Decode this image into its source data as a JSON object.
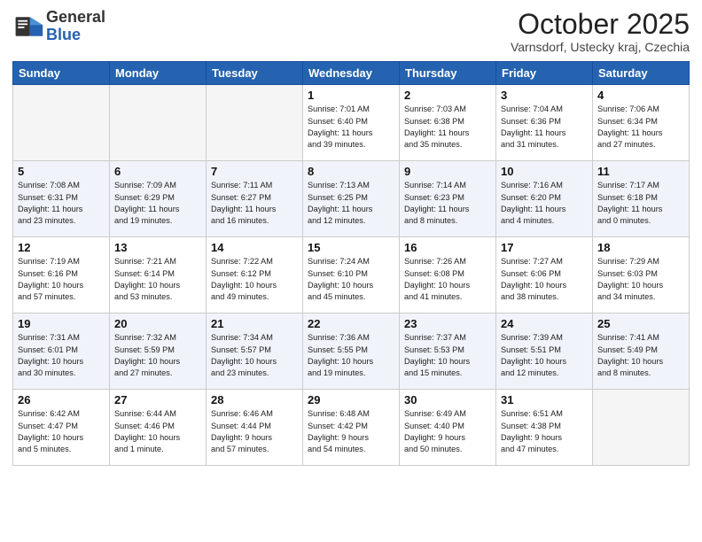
{
  "logo": {
    "general": "General",
    "blue": "Blue"
  },
  "header": {
    "month": "October 2025",
    "location": "Varnsdorf, Ustecky kraj, Czechia"
  },
  "weekdays": [
    "Sunday",
    "Monday",
    "Tuesday",
    "Wednesday",
    "Thursday",
    "Friday",
    "Saturday"
  ],
  "weeks": [
    [
      {
        "day": "",
        "info": ""
      },
      {
        "day": "",
        "info": ""
      },
      {
        "day": "",
        "info": ""
      },
      {
        "day": "1",
        "info": "Sunrise: 7:01 AM\nSunset: 6:40 PM\nDaylight: 11 hours\nand 39 minutes."
      },
      {
        "day": "2",
        "info": "Sunrise: 7:03 AM\nSunset: 6:38 PM\nDaylight: 11 hours\nand 35 minutes."
      },
      {
        "day": "3",
        "info": "Sunrise: 7:04 AM\nSunset: 6:36 PM\nDaylight: 11 hours\nand 31 minutes."
      },
      {
        "day": "4",
        "info": "Sunrise: 7:06 AM\nSunset: 6:34 PM\nDaylight: 11 hours\nand 27 minutes."
      }
    ],
    [
      {
        "day": "5",
        "info": "Sunrise: 7:08 AM\nSunset: 6:31 PM\nDaylight: 11 hours\nand 23 minutes."
      },
      {
        "day": "6",
        "info": "Sunrise: 7:09 AM\nSunset: 6:29 PM\nDaylight: 11 hours\nand 19 minutes."
      },
      {
        "day": "7",
        "info": "Sunrise: 7:11 AM\nSunset: 6:27 PM\nDaylight: 11 hours\nand 16 minutes."
      },
      {
        "day": "8",
        "info": "Sunrise: 7:13 AM\nSunset: 6:25 PM\nDaylight: 11 hours\nand 12 minutes."
      },
      {
        "day": "9",
        "info": "Sunrise: 7:14 AM\nSunset: 6:23 PM\nDaylight: 11 hours\nand 8 minutes."
      },
      {
        "day": "10",
        "info": "Sunrise: 7:16 AM\nSunset: 6:20 PM\nDaylight: 11 hours\nand 4 minutes."
      },
      {
        "day": "11",
        "info": "Sunrise: 7:17 AM\nSunset: 6:18 PM\nDaylight: 11 hours\nand 0 minutes."
      }
    ],
    [
      {
        "day": "12",
        "info": "Sunrise: 7:19 AM\nSunset: 6:16 PM\nDaylight: 10 hours\nand 57 minutes."
      },
      {
        "day": "13",
        "info": "Sunrise: 7:21 AM\nSunset: 6:14 PM\nDaylight: 10 hours\nand 53 minutes."
      },
      {
        "day": "14",
        "info": "Sunrise: 7:22 AM\nSunset: 6:12 PM\nDaylight: 10 hours\nand 49 minutes."
      },
      {
        "day": "15",
        "info": "Sunrise: 7:24 AM\nSunset: 6:10 PM\nDaylight: 10 hours\nand 45 minutes."
      },
      {
        "day": "16",
        "info": "Sunrise: 7:26 AM\nSunset: 6:08 PM\nDaylight: 10 hours\nand 41 minutes."
      },
      {
        "day": "17",
        "info": "Sunrise: 7:27 AM\nSunset: 6:06 PM\nDaylight: 10 hours\nand 38 minutes."
      },
      {
        "day": "18",
        "info": "Sunrise: 7:29 AM\nSunset: 6:03 PM\nDaylight: 10 hours\nand 34 minutes."
      }
    ],
    [
      {
        "day": "19",
        "info": "Sunrise: 7:31 AM\nSunset: 6:01 PM\nDaylight: 10 hours\nand 30 minutes."
      },
      {
        "day": "20",
        "info": "Sunrise: 7:32 AM\nSunset: 5:59 PM\nDaylight: 10 hours\nand 27 minutes."
      },
      {
        "day": "21",
        "info": "Sunrise: 7:34 AM\nSunset: 5:57 PM\nDaylight: 10 hours\nand 23 minutes."
      },
      {
        "day": "22",
        "info": "Sunrise: 7:36 AM\nSunset: 5:55 PM\nDaylight: 10 hours\nand 19 minutes."
      },
      {
        "day": "23",
        "info": "Sunrise: 7:37 AM\nSunset: 5:53 PM\nDaylight: 10 hours\nand 15 minutes."
      },
      {
        "day": "24",
        "info": "Sunrise: 7:39 AM\nSunset: 5:51 PM\nDaylight: 10 hours\nand 12 minutes."
      },
      {
        "day": "25",
        "info": "Sunrise: 7:41 AM\nSunset: 5:49 PM\nDaylight: 10 hours\nand 8 minutes."
      }
    ],
    [
      {
        "day": "26",
        "info": "Sunrise: 6:42 AM\nSunset: 4:47 PM\nDaylight: 10 hours\nand 5 minutes."
      },
      {
        "day": "27",
        "info": "Sunrise: 6:44 AM\nSunset: 4:46 PM\nDaylight: 10 hours\nand 1 minute."
      },
      {
        "day": "28",
        "info": "Sunrise: 6:46 AM\nSunset: 4:44 PM\nDaylight: 9 hours\nand 57 minutes."
      },
      {
        "day": "29",
        "info": "Sunrise: 6:48 AM\nSunset: 4:42 PM\nDaylight: 9 hours\nand 54 minutes."
      },
      {
        "day": "30",
        "info": "Sunrise: 6:49 AM\nSunset: 4:40 PM\nDaylight: 9 hours\nand 50 minutes."
      },
      {
        "day": "31",
        "info": "Sunrise: 6:51 AM\nSunset: 4:38 PM\nDaylight: 9 hours\nand 47 minutes."
      },
      {
        "day": "",
        "info": ""
      }
    ]
  ]
}
